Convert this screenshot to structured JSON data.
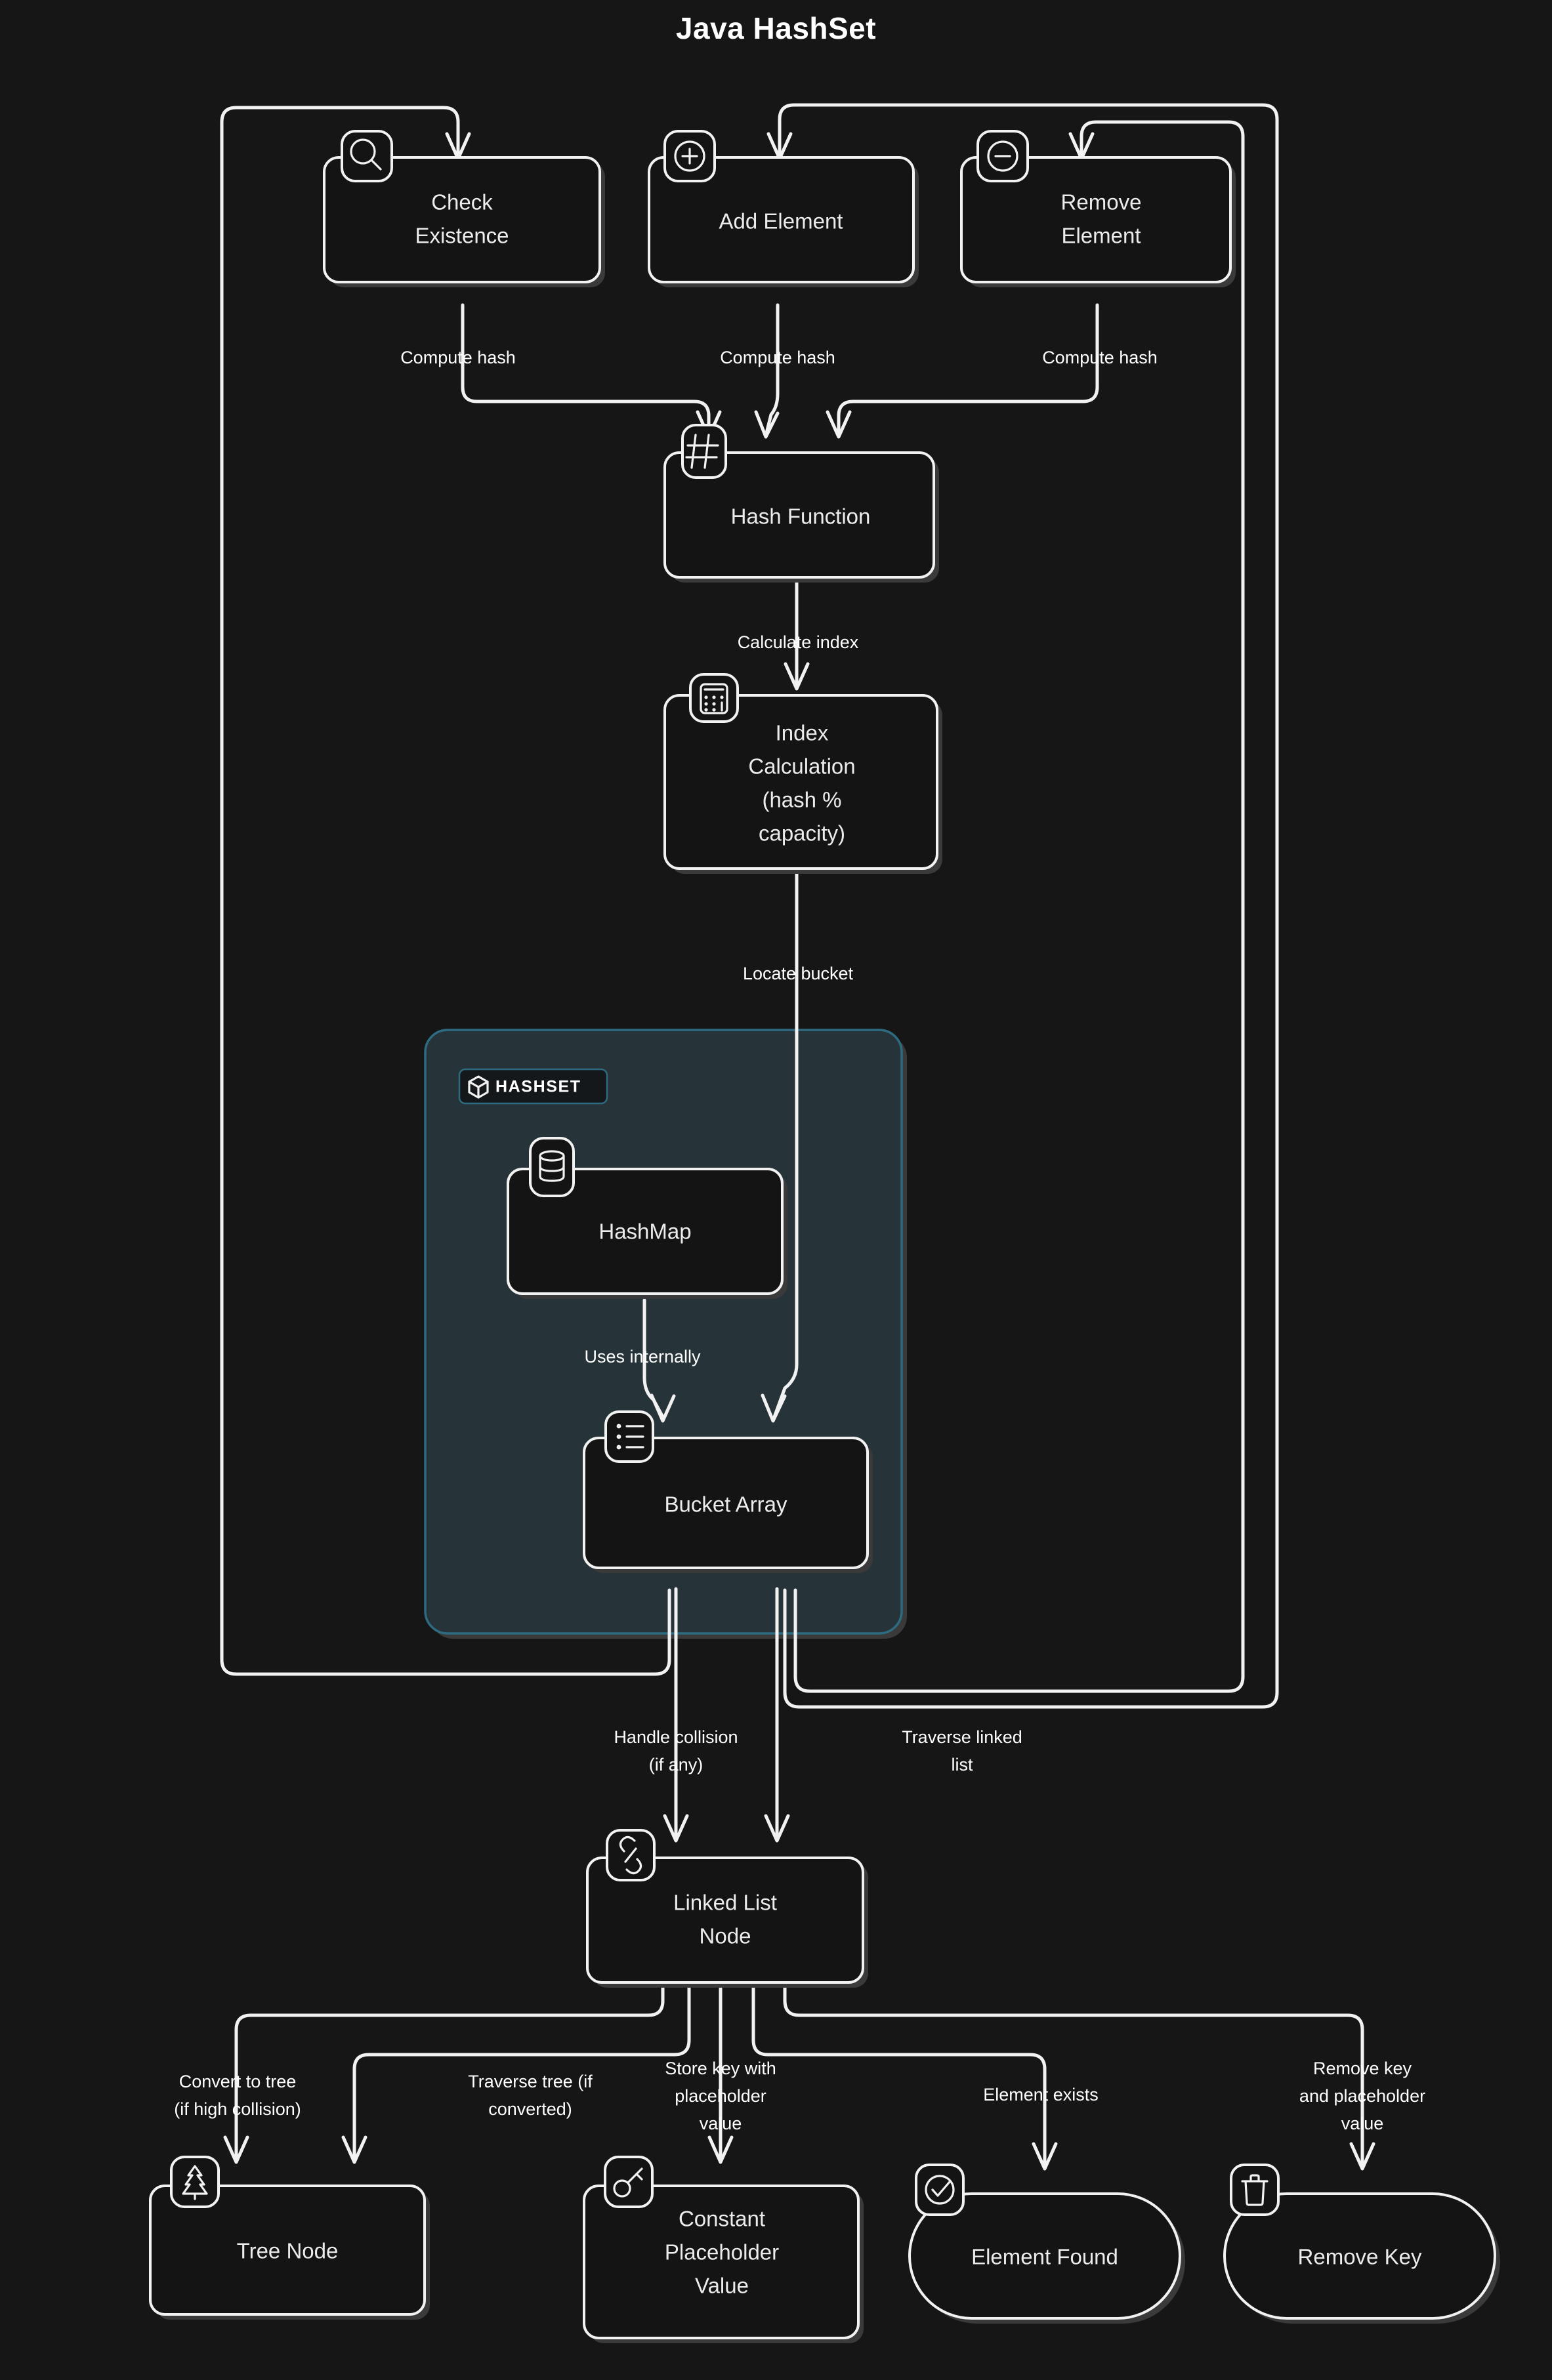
{
  "title": "Java HashSet",
  "theme": {
    "background": "#161616",
    "node_fill": "#141414",
    "node_stroke": "#f2f2f2",
    "edge_stroke": "#f2f2f2",
    "text": "#ececec",
    "label_text": "#ffffff",
    "subgraph_fill": "#26343a",
    "subgraph_stroke": "#2e6a80",
    "shadow": "#3a3a3a"
  },
  "subgraph": {
    "id": "hashset",
    "label": "HASHSET",
    "icon": "cube-icon"
  },
  "nodes": [
    {
      "id": "check",
      "label": "Check Existence",
      "icon": "search-icon",
      "shape": "rounded-rect"
    },
    {
      "id": "add",
      "label": "Add Element",
      "icon": "plus-circle-icon",
      "shape": "rounded-rect"
    },
    {
      "id": "remove",
      "label": "Remove Element",
      "icon": "minus-circle-icon",
      "shape": "rounded-rect"
    },
    {
      "id": "hashfn",
      "label": "Hash Function",
      "icon": "hash-icon",
      "shape": "rounded-rect"
    },
    {
      "id": "index",
      "label": "Index Calculation (hash % capacity)",
      "icon": "calculator-icon",
      "shape": "rounded-rect"
    },
    {
      "id": "hashmap",
      "label": "HashMap",
      "icon": "database-icon",
      "shape": "rounded-rect"
    },
    {
      "id": "bucket",
      "label": "Bucket Array",
      "icon": "list-icon",
      "shape": "rounded-rect"
    },
    {
      "id": "linked",
      "label": "Linked List Node",
      "icon": "link-icon",
      "shape": "rounded-rect"
    },
    {
      "id": "tree",
      "label": "Tree Node",
      "icon": "tree-icon",
      "shape": "rounded-rect"
    },
    {
      "id": "constant",
      "label": "Constant Placeholder Value",
      "icon": "key-icon",
      "shape": "rounded-rect"
    },
    {
      "id": "found",
      "label": "Element Found",
      "icon": "check-circle-icon",
      "shape": "stadium"
    },
    {
      "id": "removekey",
      "label": "Remove Key",
      "icon": "trash-icon",
      "shape": "stadium"
    }
  ],
  "node_lines": {
    "check": [
      "Check",
      "Existence"
    ],
    "add": [
      "Add Element"
    ],
    "remove": [
      "Remove",
      "Element"
    ],
    "hashfn": [
      "Hash Function"
    ],
    "index": [
      "Index",
      "Calculation",
      "(hash %",
      "capacity)"
    ],
    "hashmap": [
      "HashMap"
    ],
    "bucket": [
      "Bucket Array"
    ],
    "linked": [
      "Linked List",
      "Node"
    ],
    "tree": [
      "Tree Node"
    ],
    "constant": [
      "Constant",
      "Placeholder",
      "Value"
    ],
    "found": [
      "Element Found"
    ],
    "removekey": [
      "Remove Key"
    ]
  },
  "edges": [
    {
      "id": "e1",
      "from": "check",
      "to": "hashfn",
      "label": "Compute hash",
      "label_lines": [
        "Compute hash"
      ]
    },
    {
      "id": "e2",
      "from": "add",
      "to": "hashfn",
      "label": "Compute hash",
      "label_lines": [
        "Compute hash"
      ]
    },
    {
      "id": "e3",
      "from": "remove",
      "to": "hashfn",
      "label": "Compute hash",
      "label_lines": [
        "Compute hash"
      ]
    },
    {
      "id": "e4",
      "from": "hashfn",
      "to": "index",
      "label": "Calculate index",
      "label_lines": [
        "Calculate index"
      ]
    },
    {
      "id": "e5",
      "from": "index",
      "to": "bucket",
      "label": "Locate bucket",
      "label_lines": [
        "Locate bucket"
      ]
    },
    {
      "id": "e6",
      "from": "hashmap",
      "to": "bucket",
      "label": "Uses internally",
      "label_lines": [
        "Uses internally"
      ]
    },
    {
      "id": "e7",
      "from": "bucket",
      "to": "linked",
      "label": "Handle collision (if any)",
      "label_lines": [
        "Handle collision",
        "(if any)"
      ]
    },
    {
      "id": "e8",
      "from": "bucket",
      "to": "linked",
      "label": "Traverse linked list",
      "label_lines": [
        "Traverse linked",
        "list"
      ]
    },
    {
      "id": "e9",
      "from": "linked",
      "to": "tree",
      "label": "Convert to tree (if high collision)",
      "label_lines": [
        "Convert to tree",
        "(if high collision)"
      ]
    },
    {
      "id": "e10",
      "from": "linked",
      "to": "tree",
      "label": "Traverse tree (if converted)",
      "label_lines": [
        "Traverse tree (if",
        "converted)"
      ]
    },
    {
      "id": "e11",
      "from": "linked",
      "to": "constant",
      "label": "Store key with placeholder value",
      "label_lines": [
        "Store key with",
        "placeholder",
        "value"
      ]
    },
    {
      "id": "e12",
      "from": "linked",
      "to": "found",
      "label": "Element exists",
      "label_lines": [
        "Element exists"
      ]
    },
    {
      "id": "e13",
      "from": "linked",
      "to": "removekey",
      "label": "Remove key and placeholder value",
      "label_lines": [
        "Remove key",
        "and placeholder",
        "value"
      ]
    }
  ]
}
